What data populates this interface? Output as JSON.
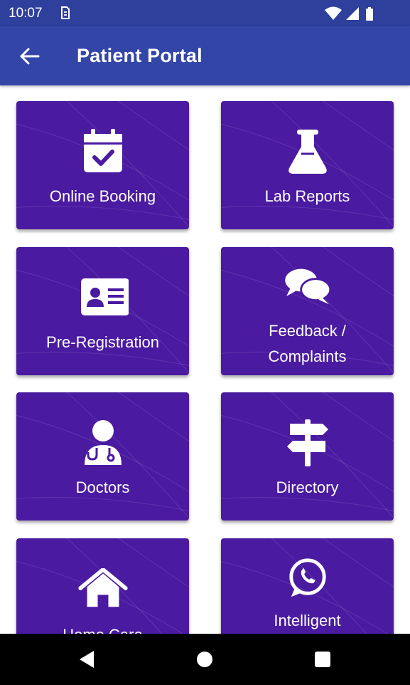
{
  "status_bar": {
    "time": "10:07"
  },
  "app_bar": {
    "title": "Patient Portal"
  },
  "tiles": [
    {
      "label": "Online Booking",
      "icon": "calendar-check-icon"
    },
    {
      "label": "Lab Reports",
      "icon": "flask-icon"
    },
    {
      "label": "Pre-Registration",
      "icon": "id-card-icon"
    },
    {
      "label_line1": "Feedback /",
      "label_line2": "Complaints",
      "icon": "comments-icon"
    },
    {
      "label": "Doctors",
      "icon": "doctor-icon"
    },
    {
      "label": "Directory",
      "icon": "signpost-icon"
    },
    {
      "label": "Home Care",
      "icon": "home-icon"
    },
    {
      "label": "Intelligent",
      "icon": "whatsapp-icon"
    }
  ],
  "colors": {
    "status_bar": "#2e3f9c",
    "app_bar": "#3346a8",
    "tile": "#4a1aa1"
  }
}
